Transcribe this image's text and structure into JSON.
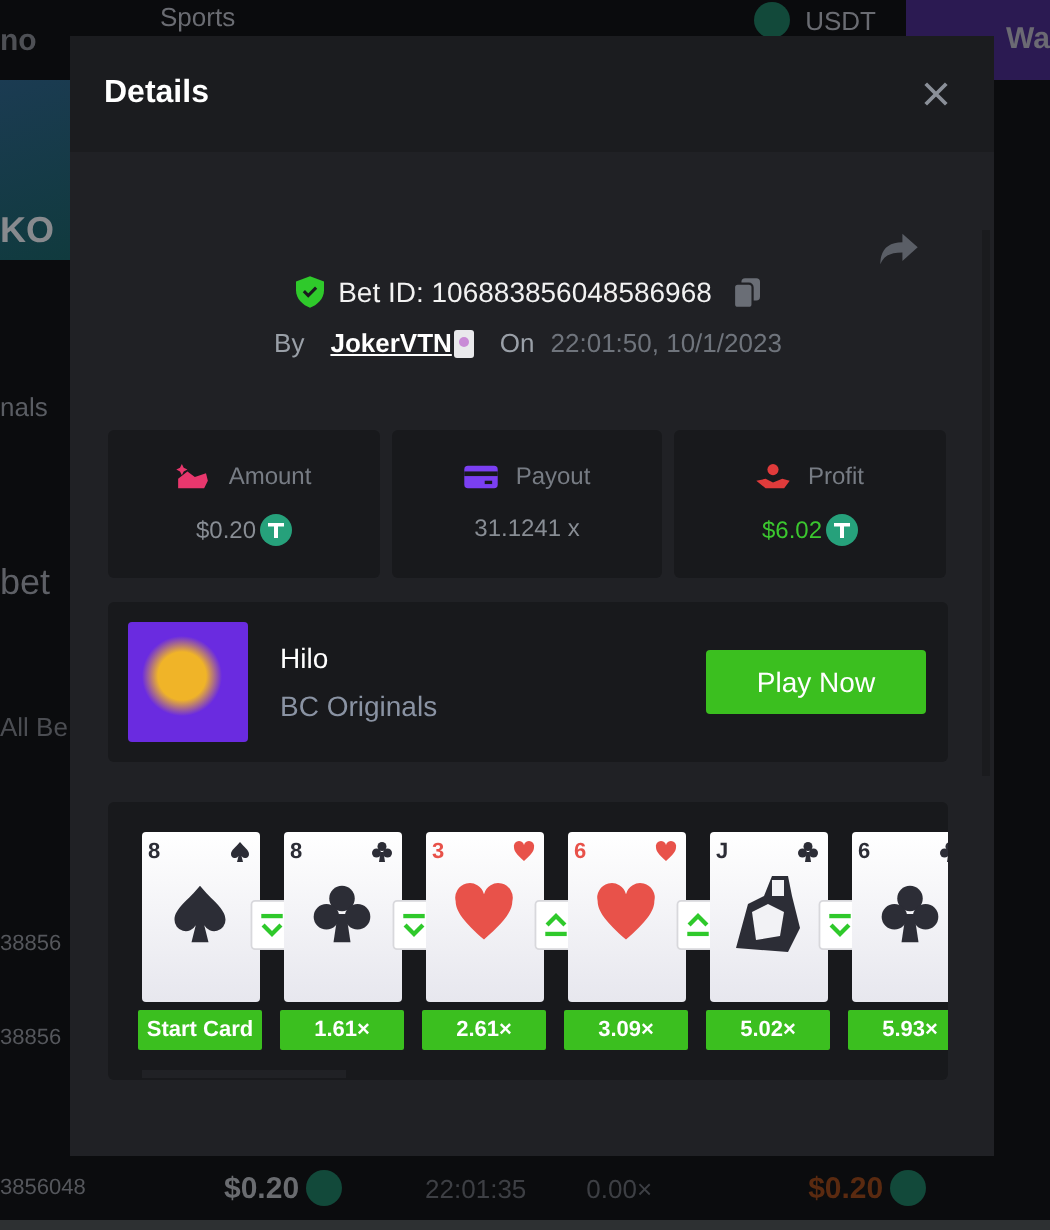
{
  "background": {
    "nav": {
      "brand": "no",
      "sports": "Sports",
      "currency": "USDT",
      "wallet": "Wa"
    },
    "side": [
      {
        "kind": "banner",
        "text": "KO"
      },
      {
        "kind": "link",
        "text": "nals"
      },
      {
        "kind": "heading",
        "text": "bet"
      },
      {
        "kind": "tab",
        "text": "All Be"
      },
      {
        "kind": "row",
        "text": "38856"
      },
      {
        "kind": "row",
        "text": "38856"
      }
    ],
    "bottom_row": {
      "id": "3856048",
      "amount": "$0.20",
      "time": "22:01:35",
      "payout": "0.00×",
      "profit": "$0.20"
    }
  },
  "modal": {
    "title": "Details",
    "bet_id": "Bet ID: 106883856048586968",
    "by_label": "By",
    "user": "JokerVTN",
    "on_label": "On",
    "datetime": "22:01:50, 10/1/2023",
    "stats": [
      {
        "kind": "amount",
        "label": "Amount",
        "value": "$0.20",
        "coin": true,
        "positive": false
      },
      {
        "kind": "payout",
        "label": "Payout",
        "value": "31.1241 x",
        "coin": false,
        "positive": false
      },
      {
        "kind": "profit",
        "label": "Profit",
        "value": "$6.02",
        "coin": true,
        "positive": true
      }
    ],
    "game": {
      "name": "Hilo",
      "provider": "BC Originals",
      "button": "Play Now"
    },
    "cards": [
      {
        "rank": "8",
        "kind": "spade",
        "label": "Start Card"
      },
      {
        "rank": "8",
        "kind": "club",
        "higher": false,
        "label": "1.61×"
      },
      {
        "rank": "3",
        "kind": "heart",
        "higher": false,
        "label": "2.61×"
      },
      {
        "rank": "6",
        "kind": "heart",
        "higher": true,
        "label": "3.09×"
      },
      {
        "rank": "J",
        "kind": "club",
        "higher": true,
        "label": "5.02×"
      },
      {
        "rank": "6",
        "kind": "club",
        "higher": false,
        "label": "5.93×"
      }
    ]
  }
}
